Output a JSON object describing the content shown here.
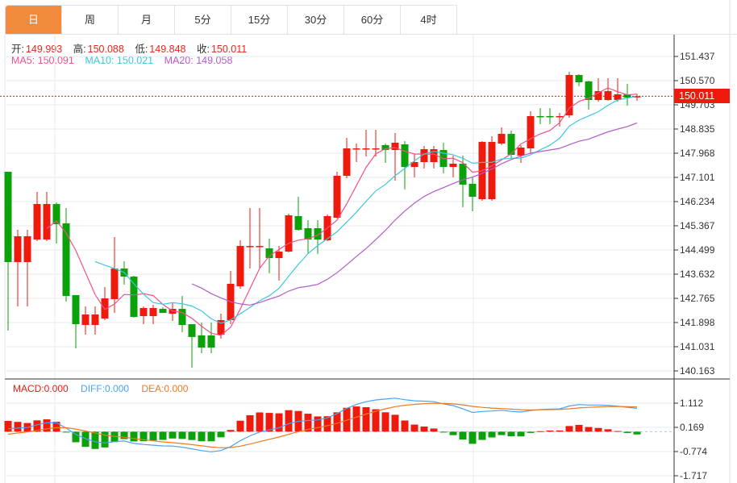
{
  "tabs": [
    {
      "label": "日",
      "active": true
    },
    {
      "label": "周"
    },
    {
      "label": "月"
    },
    {
      "label": "5分"
    },
    {
      "label": "15分"
    },
    {
      "label": "30分"
    },
    {
      "label": "60分"
    },
    {
      "label": "4时"
    }
  ],
  "ohlc_info": {
    "open_label": "开:",
    "open": "149.993",
    "high_label": "高:",
    "high": "150.088",
    "low_label": "低:",
    "low": "149.848",
    "close_label": "收:",
    "close": "150.011"
  },
  "ma_info": {
    "ma5": "MA5: 150.091",
    "ma10": "MA10: 150.021",
    "ma20": "MA20: 149.058"
  },
  "macd_info": {
    "macd": "MACD:0.000",
    "diff": "DIFF:0.000",
    "dea": "DEA:0.000"
  },
  "current_price": "150.011",
  "colors": {
    "up": "#ee1a0e",
    "down": "#0aa10a",
    "ma5": "#f0508c",
    "ma10": "#3cc8dc",
    "ma20": "#b45ac8",
    "diff": "#4aa3f0",
    "dea": "#f07820",
    "active_tab": "#f28a3c"
  },
  "chart_data": {
    "type": "candlestick",
    "price_axis_ticks": [
      "151.437",
      "150.570",
      "149.703",
      "148.835",
      "147.968",
      "147.101",
      "146.234",
      "145.367",
      "144.499",
      "143.632",
      "142.765",
      "141.898",
      "141.031",
      "140.163"
    ],
    "price_range": [
      140.163,
      151.437
    ],
    "macd_axis_ticks": [
      "1.112",
      "0.169",
      "-0.774",
      "-1.717"
    ],
    "macd_range": [
      -1.717,
      1.112
    ],
    "candles": [
      [
        147.303,
        147.303,
        141.607,
        144.065
      ],
      [
        144.065,
        145.221,
        142.475,
        144.99
      ],
      [
        144.065,
        145.221,
        142.475,
        144.99
      ],
      [
        144.874,
        146.58,
        144.817,
        146.146
      ],
      [
        144.874,
        146.58,
        144.817,
        146.146
      ],
      [
        146.146,
        146.204,
        144.73,
        145.424
      ],
      [
        145.453,
        146.002,
        142.648,
        142.85
      ],
      [
        142.88,
        142.88,
        140.972,
        141.839
      ],
      [
        141.81,
        142.475,
        141.463,
        142.186
      ],
      [
        141.81,
        142.475,
        141.463,
        142.186
      ],
      [
        142.041,
        143.169,
        141.984,
        142.764
      ],
      [
        142.735,
        144.961,
        142.243,
        143.834
      ],
      [
        143.834,
        144.094,
        143.255,
        143.545
      ],
      [
        143.545,
        143.574,
        142.07,
        142.099
      ],
      [
        142.128,
        142.475,
        141.839,
        142.417
      ],
      [
        142.128,
        142.532,
        141.839,
        142.417
      ],
      [
        142.388,
        142.446,
        142.243,
        142.243
      ],
      [
        142.214,
        142.619,
        141.955,
        142.388
      ],
      [
        142.388,
        142.85,
        141.549,
        141.81
      ],
      [
        141.839,
        141.839,
        140.278,
        141.379
      ],
      [
        141.437,
        141.897,
        140.799,
        141.001
      ],
      [
        141.437,
        141.897,
        140.799,
        141.001
      ],
      [
        141.463,
        142.214,
        141.319,
        141.984
      ],
      [
        141.984,
        143.747,
        141.839,
        143.285
      ],
      [
        143.198,
        144.846,
        143.111,
        144.643
      ],
      [
        144.614,
        146.002,
        143.834,
        144.643
      ],
      [
        144.614,
        146.002,
        143.834,
        144.643
      ],
      [
        144.557,
        144.904,
        143.66,
        144.209
      ],
      [
        144.209,
        144.643,
        143.4,
        144.441
      ],
      [
        144.441,
        145.8,
        144.412,
        145.742
      ],
      [
        145.713,
        146.407,
        145.192,
        145.221
      ],
      [
        145.279,
        145.568,
        144.354,
        144.874
      ],
      [
        145.279,
        145.568,
        144.354,
        144.874
      ],
      [
        144.846,
        145.771,
        144.817,
        145.713
      ],
      [
        145.655,
        147.303,
        145.626,
        147.158
      ],
      [
        147.158,
        148.517,
        147.072,
        148.141
      ],
      [
        148.112,
        148.315,
        147.65,
        148.141
      ],
      [
        148.112,
        148.806,
        147.852,
        148.141
      ],
      [
        148.112,
        148.806,
        147.852,
        148.141
      ],
      [
        148.257,
        148.315,
        147.621,
        148.083
      ],
      [
        148.083,
        148.691,
        146.985,
        148.344
      ],
      [
        148.286,
        148.401,
        146.667,
        147.476
      ],
      [
        147.476,
        147.939,
        147.101,
        147.65
      ],
      [
        147.65,
        148.228,
        147.419,
        148.112
      ],
      [
        147.65,
        148.228,
        147.419,
        148.112
      ],
      [
        148.083,
        148.344,
        147.245,
        147.476
      ],
      [
        147.476,
        147.881,
        147.101,
        147.592
      ],
      [
        147.592,
        147.881,
        146.031,
        146.84
      ],
      [
        146.869,
        147.101,
        145.886,
        146.407
      ],
      [
        146.32,
        148.401,
        146.262,
        148.372
      ],
      [
        146.32,
        148.575,
        146.262,
        148.372
      ],
      [
        148.315,
        148.893,
        148.257,
        148.662
      ],
      [
        148.662,
        148.777,
        147.794,
        147.91
      ],
      [
        147.881,
        148.257,
        147.621,
        148.17
      ],
      [
        148.141,
        149.471,
        147.939,
        149.298
      ],
      [
        149.298,
        149.587,
        149.009,
        149.269
      ],
      [
        149.298,
        149.587,
        149.009,
        149.269
      ],
      [
        149.269,
        149.413,
        148.922,
        149.298
      ],
      [
        149.327,
        150.888,
        149.24,
        150.772
      ],
      [
        150.772,
        150.8,
        150.367,
        150.512
      ],
      [
        150.541,
        150.57,
        149.529,
        149.876
      ],
      [
        149.876,
        150.656,
        149.818,
        150.194
      ],
      [
        149.876,
        150.656,
        149.847,
        150.194
      ],
      [
        149.876,
        150.656,
        149.818,
        150.078
      ],
      [
        150.078,
        150.454,
        149.674,
        149.963
      ],
      [
        149.993,
        150.088,
        149.848,
        150.011
      ]
    ],
    "ma_periods": [
      5,
      10,
      20
    ],
    "macd_params": [
      12,
      26,
      9
    ]
  }
}
